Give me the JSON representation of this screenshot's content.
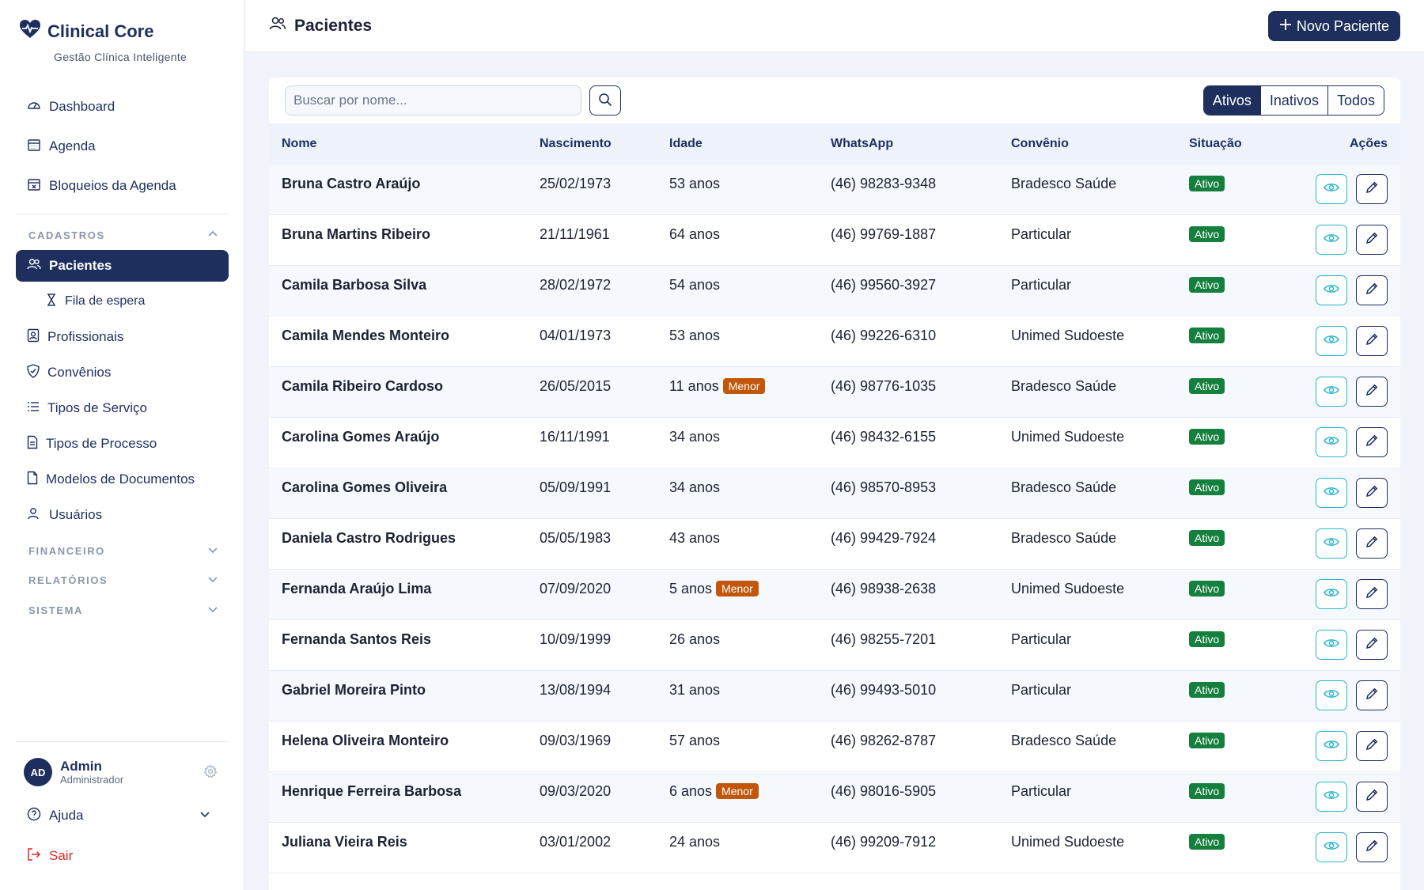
{
  "brand": {
    "title": "Clinical Core",
    "subtitle": "Gestão Clínica Inteligente"
  },
  "nav": {
    "dashboard": "Dashboard",
    "agenda": "Agenda",
    "bloqueios": "Bloqueios da Agenda",
    "cadastros_section": "CADASTROS",
    "pacientes": "Pacientes",
    "fila": "Fila de espera",
    "profissionais": "Profissionais",
    "convenios": "Convênios",
    "tipos_servico": "Tipos de Serviço",
    "tipos_processo": "Tipos de Processo",
    "modelos": "Modelos de Documentos",
    "usuarios": "Usuários",
    "financeiro_section": "FINANCEIRO",
    "relatorios_section": "RELATÓRIOS",
    "sistema_section": "SISTEMA"
  },
  "user": {
    "initials": "AD",
    "name": "Admin",
    "role": "Administrador"
  },
  "help": {
    "label": "Ajuda"
  },
  "logout": {
    "label": "Sair"
  },
  "header": {
    "title": "Pacientes",
    "new_button": "Novo Paciente"
  },
  "search": {
    "placeholder": "Buscar por nome..."
  },
  "filters": {
    "active": "Ativos",
    "inactive": "Inativos",
    "all": "Todos",
    "selected": "Ativos"
  },
  "table": {
    "columns": {
      "nome": "Nome",
      "nascimento": "Nascimento",
      "idade": "Idade",
      "whatsapp": "WhatsApp",
      "convenio": "Convênio",
      "situacao": "Situação",
      "acoes": "Ações"
    },
    "rows": [
      {
        "nome": "Bruna Castro Araújo",
        "nascimento": "25/02/1973",
        "idade": "53 anos",
        "menor": "",
        "whatsapp": "(46) 98283-9348",
        "convenio": "Bradesco Saúde",
        "situacao": "Ativo"
      },
      {
        "nome": "Bruna Martins Ribeiro",
        "nascimento": "21/11/1961",
        "idade": "64 anos",
        "menor": "",
        "whatsapp": "(46) 99769-1887",
        "convenio": "Particular",
        "situacao": "Ativo"
      },
      {
        "nome": "Camila Barbosa Silva",
        "nascimento": "28/02/1972",
        "idade": "54 anos",
        "menor": "",
        "whatsapp": "(46) 99560-3927",
        "convenio": "Particular",
        "situacao": "Ativo"
      },
      {
        "nome": "Camila Mendes Monteiro",
        "nascimento": "04/01/1973",
        "idade": "53 anos",
        "menor": "",
        "whatsapp": "(46) 99226-6310",
        "convenio": "Unimed Sudoeste",
        "situacao": "Ativo"
      },
      {
        "nome": "Camila Ribeiro Cardoso",
        "nascimento": "26/05/2015",
        "idade": "11 anos",
        "menor": "Menor",
        "whatsapp": "(46) 98776-1035",
        "convenio": "Bradesco Saúde",
        "situacao": "Ativo"
      },
      {
        "nome": "Carolina Gomes Araújo",
        "nascimento": "16/11/1991",
        "idade": "34 anos",
        "menor": "",
        "whatsapp": "(46) 98432-6155",
        "convenio": "Unimed Sudoeste",
        "situacao": "Ativo"
      },
      {
        "nome": "Carolina Gomes Oliveira",
        "nascimento": "05/09/1991",
        "idade": "34 anos",
        "menor": "",
        "whatsapp": "(46) 98570-8953",
        "convenio": "Bradesco Saúde",
        "situacao": "Ativo"
      },
      {
        "nome": "Daniela Castro Rodrigues",
        "nascimento": "05/05/1983",
        "idade": "43 anos",
        "menor": "",
        "whatsapp": "(46) 99429-7924",
        "convenio": "Bradesco Saúde",
        "situacao": "Ativo"
      },
      {
        "nome": "Fernanda Araújo Lima",
        "nascimento": "07/09/2020",
        "idade": "5 anos",
        "menor": "Menor",
        "whatsapp": "(46) 98938-2638",
        "convenio": "Unimed Sudoeste",
        "situacao": "Ativo"
      },
      {
        "nome": "Fernanda Santos Reis",
        "nascimento": "10/09/1999",
        "idade": "26 anos",
        "menor": "",
        "whatsapp": "(46) 98255-7201",
        "convenio": "Particular",
        "situacao": "Ativo"
      },
      {
        "nome": "Gabriel Moreira Pinto",
        "nascimento": "13/08/1994",
        "idade": "31 anos",
        "menor": "",
        "whatsapp": "(46) 99493-5010",
        "convenio": "Particular",
        "situacao": "Ativo"
      },
      {
        "nome": "Helena Oliveira Monteiro",
        "nascimento": "09/03/1969",
        "idade": "57 anos",
        "menor": "",
        "whatsapp": "(46) 98262-8787",
        "convenio": "Bradesco Saúde",
        "situacao": "Ativo"
      },
      {
        "nome": "Henrique Ferreira Barbosa",
        "nascimento": "09/03/2020",
        "idade": "6 anos",
        "menor": "Menor",
        "whatsapp": "(46) 98016-5905",
        "convenio": "Particular",
        "situacao": "Ativo"
      },
      {
        "nome": "Juliana Vieira Reis",
        "nascimento": "03/01/2002",
        "idade": "24 anos",
        "menor": "",
        "whatsapp": "(46) 99209-7912",
        "convenio": "Unimed Sudoeste",
        "situacao": "Ativo"
      }
    ]
  },
  "colors": {
    "primary": "#1e2f5e",
    "accent_teal": "#2ab6c8",
    "active_green": "#15803d",
    "minor_orange": "#c2570c",
    "logout_red": "#dc2626"
  },
  "icons": {
    "brand": "heart-pulse-icon",
    "dashboard": "gauge-icon",
    "agenda": "calendar-icon",
    "bloqueios": "calendar-x-icon",
    "pacientes": "users-icon",
    "fila": "hourglass-icon",
    "profissionais": "id-badge-icon",
    "convenios": "shield-icon",
    "tipos_servico": "list-icon",
    "tipos_processo": "file-icon",
    "modelos": "document-icon",
    "usuarios": "user-icon",
    "settings": "gear-icon",
    "help": "help-circle-icon",
    "logout": "logout-icon",
    "search": "search-icon",
    "view": "eye-icon",
    "edit": "pencil-icon"
  }
}
